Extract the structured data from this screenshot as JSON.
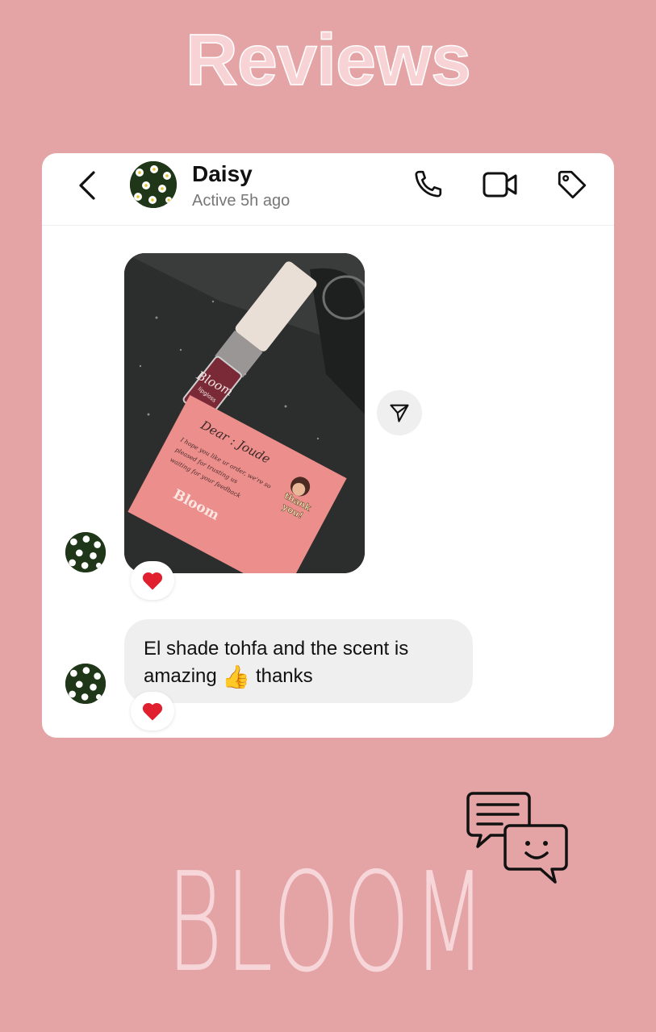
{
  "page": {
    "heading": "Reviews",
    "brand": "BLOOM",
    "background_color": "#e4a4a6"
  },
  "conversation": {
    "contact_name": "Daisy",
    "status": "Active 5h ago",
    "icons": {
      "back": "back-chevron-icon",
      "call": "phone-icon",
      "video": "video-camera-icon",
      "tag": "tag-icon",
      "share": "send-icon"
    },
    "messages": [
      {
        "type": "image",
        "photo_text": {
          "bottle_brand": "Bloom",
          "bottle_sub": "lipgloss",
          "card_greeting": "Dear : Joude",
          "card_line1": "I hope you like ur order, we're so",
          "card_line2": "pleased for trusting us",
          "card_line3": "waiting for your feedback",
          "card_brand": "Bloom",
          "sticker_line1": "thank",
          "sticker_line2": "you!"
        },
        "reaction": "❤️"
      },
      {
        "type": "text",
        "text_before": "El shade tohfa and the scent is amazing",
        "emoji": "👍",
        "text_after": "thanks",
        "reaction": "❤️"
      }
    ]
  }
}
